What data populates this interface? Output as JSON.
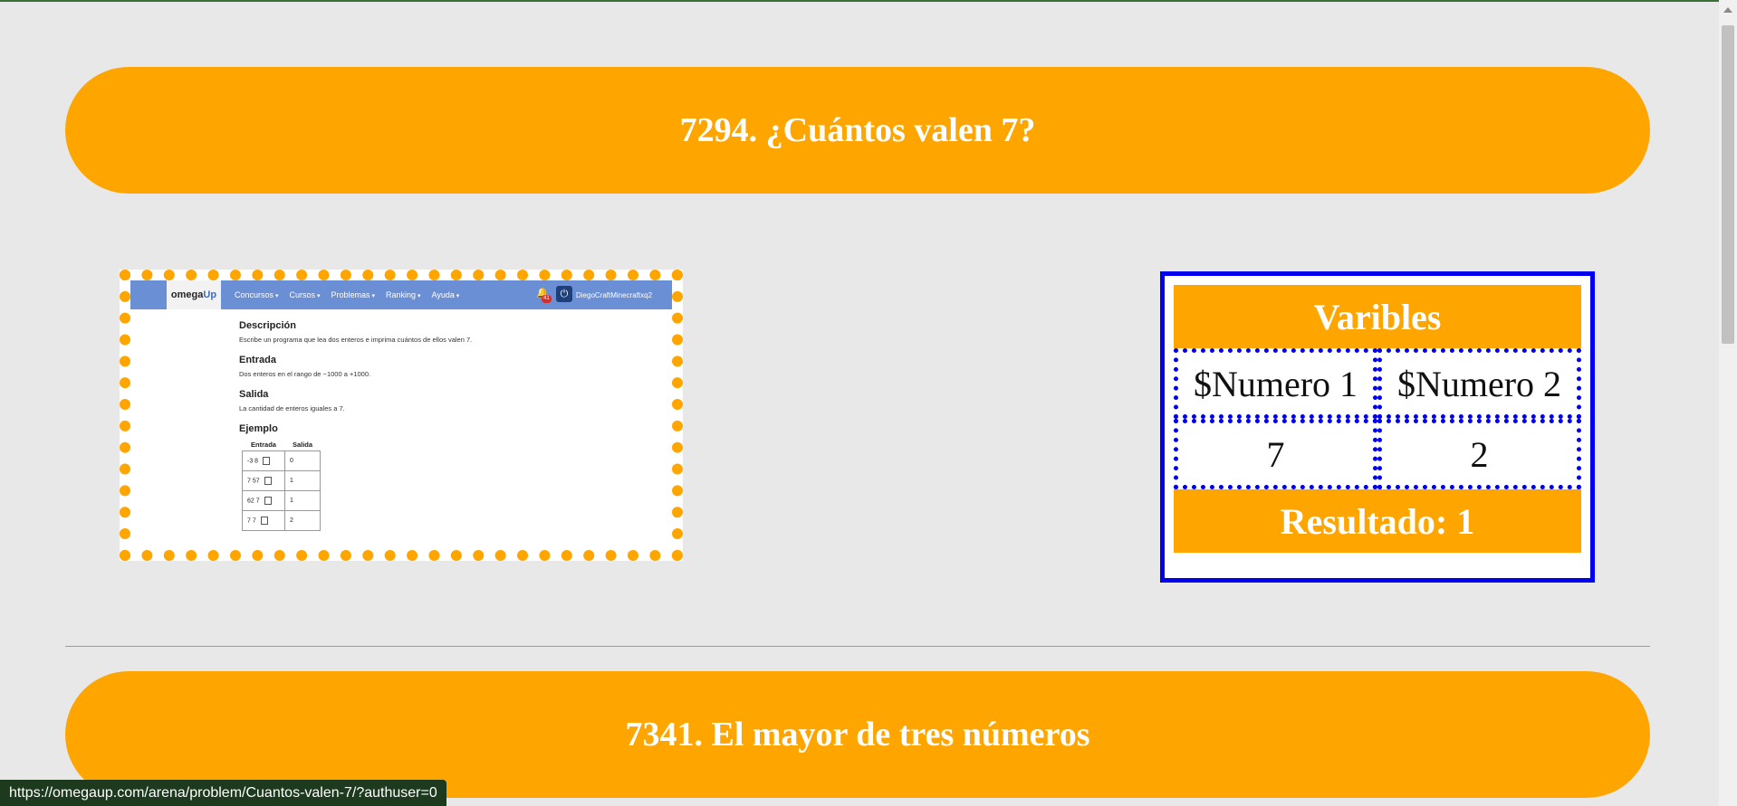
{
  "problem1": {
    "title": "7294. ¿Cuántos valen 7?"
  },
  "screenshot": {
    "logo_text": "omega",
    "logo_accent": "Up",
    "menu": [
      "Concursos",
      "Cursos",
      "Problemas",
      "Ranking",
      "Ayuda"
    ],
    "badge": "41",
    "username": "DiegoCraftMinecraftxq2",
    "descripcion_h": "Descripción",
    "descripcion_p": "Escribe un programa que lea dos enteros e imprima cuántos de ellos valen 7.",
    "entrada_h": "Entrada",
    "entrada_p": "Dos enteros en el rango de −1000 a +1000.",
    "salida_h": "Salida",
    "salida_p": "La cantidad de enteros iguales a 7.",
    "ejemplo_h": "Ejemplo",
    "table_headers": [
      "Entrada",
      "Salida"
    ],
    "rows": [
      {
        "in": "-3 8",
        "out": "0"
      },
      {
        "in": "7 57",
        "out": "1"
      },
      {
        "in": "62 7",
        "out": "1"
      },
      {
        "in": "7 7",
        "out": "2"
      }
    ]
  },
  "variables": {
    "heading": "Varibles",
    "col1": "$Numero 1",
    "col2": "$Numero 2",
    "val1": "7",
    "val2": "2",
    "result": "Resultado: 1"
  },
  "problem2": {
    "title": "7341. El mayor de tres números"
  },
  "status_bar": {
    "url": "https://omegaup.com/arena/problem/Cuantos-valen-7/?authuser=0"
  },
  "colors": {
    "accent": "#ffa500",
    "table_border": "#0000ee",
    "background": "#e8e8e8"
  }
}
